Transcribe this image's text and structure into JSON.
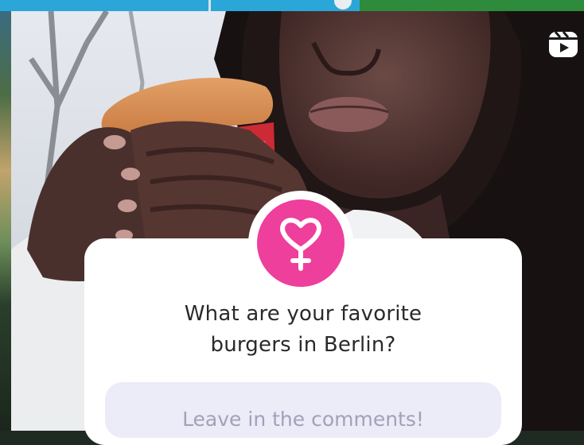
{
  "post": {
    "question_lines": [
      "What are your favorite",
      "burgers in Berlin?"
    ],
    "answer_placeholder": "Leave in the comments!",
    "badge_icon": "heart-venus-icon",
    "reels_icon": "reels-icon"
  },
  "colors": {
    "badge_pink": "#ee3f9c",
    "card_bg": "#ffffff",
    "answer_bg": "#ecebf8",
    "placeholder_text": "#a3a1b8",
    "question_text": "#2a2a2a"
  }
}
